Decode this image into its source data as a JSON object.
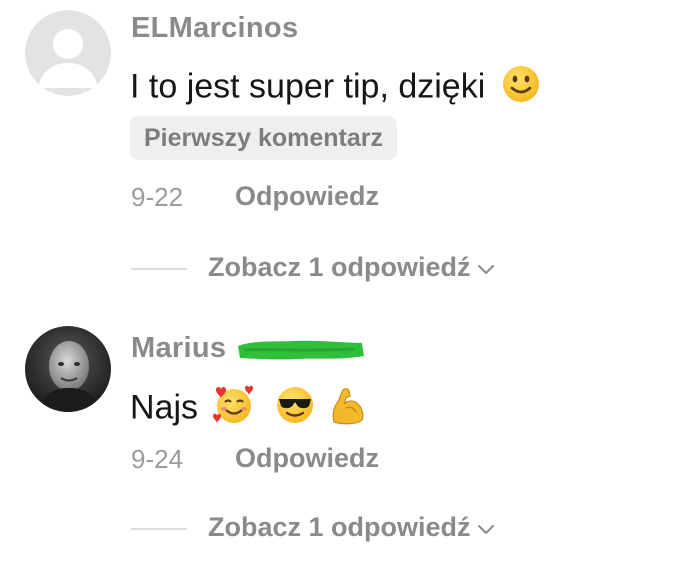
{
  "comments": [
    {
      "username": "ELMarcinos",
      "text": "I to jest super tip, dzięki",
      "emojis": [
        "slightly-smiling-face"
      ],
      "badge": "Pierwszy komentarz",
      "date": "9-22",
      "reply_label": "Odpowiedz",
      "view_replies_label": "Zobacz 1 odpowiedź",
      "avatar": "default-avatar-icon"
    },
    {
      "username": "Marius",
      "username_redacted": true,
      "text": "Najs",
      "emojis": [
        "smiling-face-with-hearts",
        "smiling-face-with-sunglasses",
        "flexed-biceps"
      ],
      "date": "9-24",
      "reply_label": "Odpowiedz",
      "view_replies_label": "Zobacz 1 odpowiedź",
      "avatar": "user-photo"
    }
  ],
  "colors": {
    "username": "#8a8a8a",
    "text": "#161616",
    "badge_bg": "#efefef",
    "redaction": "#2fbf3a"
  }
}
